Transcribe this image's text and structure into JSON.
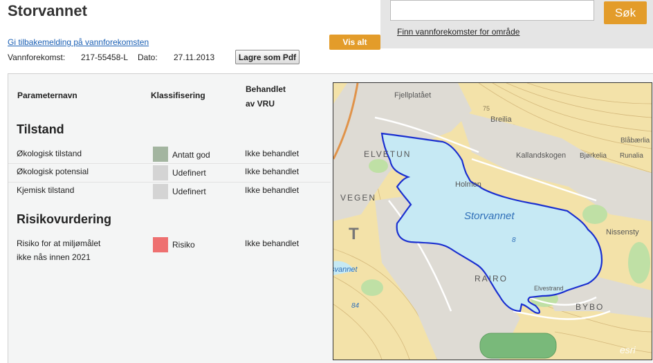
{
  "page_title": "Storvannet",
  "feedback_link": "Gi tilbakemelding på vannforekomsten",
  "meta": {
    "vannforekomst_label": "Vannforekomst:",
    "vannforekomst_value": "217-55458-L",
    "dato_label": "Dato:",
    "dato_value": "27.11.2013"
  },
  "buttons": {
    "pdf": "Lagre som Pdf",
    "vis_alt": "Vis alt",
    "sok": "Søk"
  },
  "search": {
    "value": "",
    "placeholder": "",
    "find_link": "Finn vannforekomster for område"
  },
  "table": {
    "headers": {
      "parameter": "Parameternavn",
      "klassifisering": "Klassifisering",
      "behandlet_1": "Behandlet",
      "behandlet_2": "av VRU"
    },
    "sections": [
      {
        "title": "Tilstand",
        "rows": [
          {
            "name": "Økologisk tilstand",
            "class": "Antatt god",
            "color": "#a3b5a0",
            "status": "Ikke behandlet"
          },
          {
            "name": "Økologisk potensial",
            "class": "Udefinert",
            "color": "#d4d4d4",
            "status": "Ikke behandlet"
          },
          {
            "name": "Kjemisk tilstand",
            "class": "Udefinert",
            "color": "#d4d4d4",
            "status": "Ikke behandlet"
          }
        ]
      },
      {
        "title": "Risikovurdering",
        "rows": [
          {
            "name_1": "Risiko for at miljømålet",
            "name_2": "ikke nås innen 2021",
            "class": "Risiko",
            "color": "#ee7070",
            "status": "Ikke behandlet"
          }
        ]
      }
    ]
  },
  "map": {
    "labels": {
      "fjellplatået": "Fjellplatået",
      "breilia": "Breilia",
      "elvetun": "ELVETUN",
      "kallandskogen": "Kallandskogen",
      "bjorkelia": "Bjørkelia",
      "runalia": "Runalia",
      "blabarlia": "Blåbærlia",
      "holmen": "Holmen",
      "vegen": "VEGEN",
      "storvannet": "Storvannet",
      "depth_8": "8",
      "nissensty": "Nissensty",
      "rairo": "RAIRO",
      "elvestrand": "Elvestrand",
      "bybo": "BYBO",
      "vannet": "svannet",
      "depth_84": "84",
      "letter_t": "T",
      "esri": "esri",
      "contour_75": "75"
    },
    "colors": {
      "lake": "#c6e9f4",
      "outline": "#1a2fd0",
      "terrain": "#f3e2a9"
    }
  }
}
